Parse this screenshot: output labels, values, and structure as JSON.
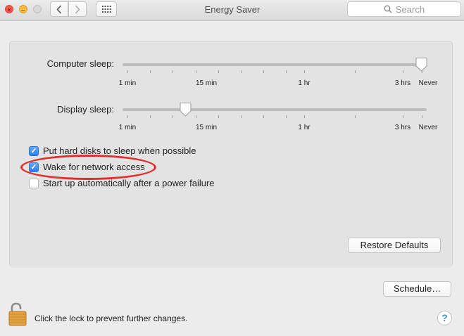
{
  "window": {
    "title": "Energy Saver",
    "search_placeholder": "Search"
  },
  "sliders": {
    "computer_sleep": {
      "label": "Computer sleep:",
      "tick_labels": [
        "1 min",
        "15 min",
        "1 hr",
        "3 hrs",
        "Never"
      ],
      "value": "Never"
    },
    "display_sleep": {
      "label": "Display sleep:",
      "tick_labels": [
        "1 min",
        "15 min",
        "1 hr",
        "3 hrs",
        "Never"
      ],
      "value": "15 min"
    }
  },
  "options": [
    {
      "label": "Put hard disks to sleep when possible",
      "checked": true
    },
    {
      "label": "Wake for network access",
      "checked": true
    },
    {
      "label": "Start up automatically after a power failure",
      "checked": false
    }
  ],
  "buttons": {
    "restore_defaults": "Restore Defaults",
    "schedule": "Schedule…"
  },
  "footer": {
    "lock_text": "Click the lock to prevent further changes.",
    "help": "?"
  },
  "colors": {
    "highlight_ring": "#e02f2f",
    "checkbox_on": "#2d7ff0",
    "lock_gold": "#e2a340"
  }
}
